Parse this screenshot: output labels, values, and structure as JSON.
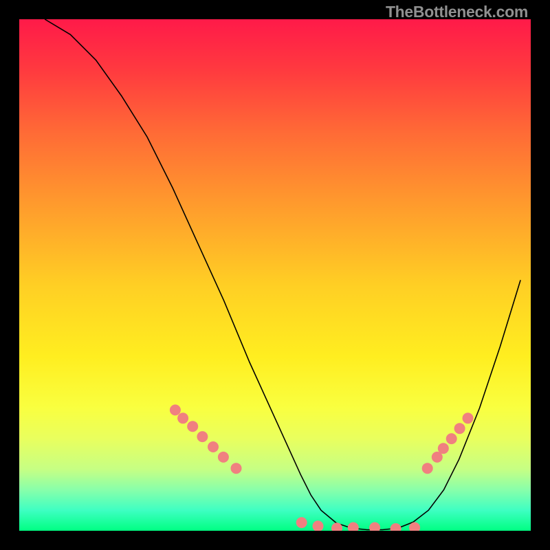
{
  "attribution": "TheBottleneck.com",
  "chart_data": {
    "type": "line",
    "title": "",
    "xlabel": "",
    "ylabel": "",
    "xlim": [
      0,
      100
    ],
    "ylim": [
      0,
      100
    ],
    "grid": false,
    "legend": false,
    "series": [
      {
        "name": "curve",
        "color": "#000000",
        "x": [
          5,
          10,
          15,
          20,
          25,
          30,
          35,
          40,
          45,
          50,
          55,
          57,
          59,
          62,
          65,
          68,
          71,
          74,
          77,
          80,
          83,
          86,
          90,
          94,
          98
        ],
        "y": [
          100,
          97,
          92,
          85,
          77,
          67,
          56,
          45,
          33,
          22,
          11,
          7,
          4,
          1.5,
          0.5,
          0.2,
          0.2,
          0.5,
          1.7,
          4,
          8,
          14,
          24,
          36,
          49
        ]
      }
    ],
    "markers": {
      "name": "highlighted-points",
      "color": "#f08080",
      "radius_px": 8,
      "x": [
        30.5,
        32.0,
        33.9,
        35.8,
        37.9,
        39.9,
        42.4,
        55.2,
        58.4,
        62.1,
        65.3,
        69.5,
        73.6,
        77.3,
        79.8,
        81.7,
        82.9,
        84.5,
        86.1,
        87.7
      ],
      "y": [
        23.6,
        22.0,
        20.4,
        18.4,
        16.4,
        14.4,
        12.2,
        1.6,
        0.9,
        0.5,
        0.6,
        0.6,
        0.4,
        0.6,
        12.2,
        14.4,
        16.1,
        18.0,
        20.0,
        22.0
      ]
    }
  }
}
